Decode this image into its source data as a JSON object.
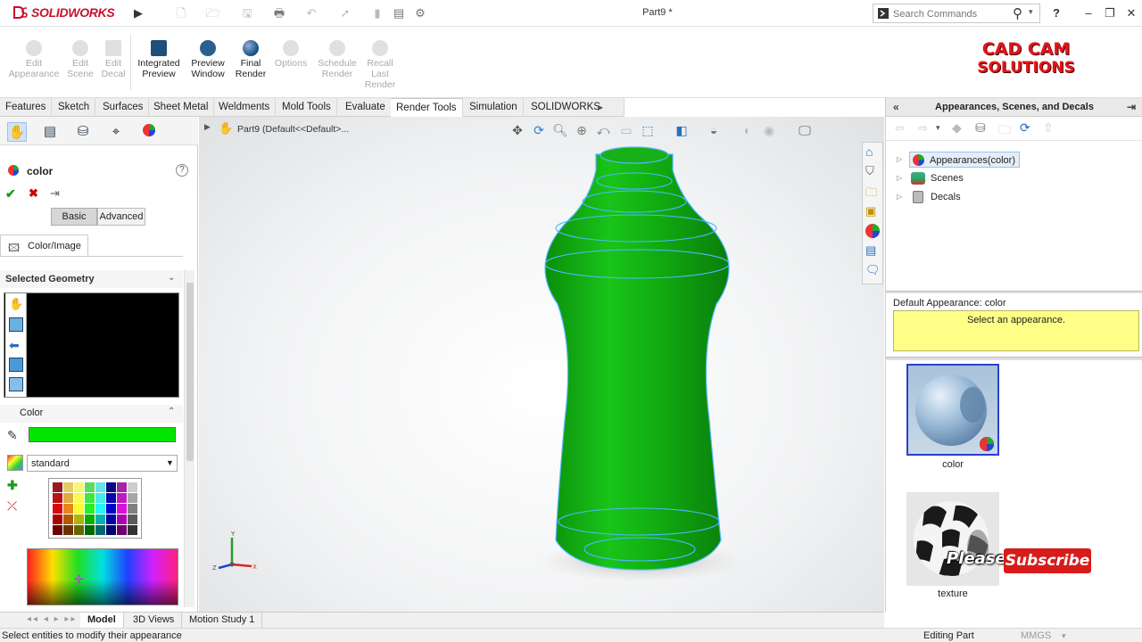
{
  "app": {
    "name": "SOLIDWORKS",
    "doc_title": "Part9 *"
  },
  "search": {
    "placeholder": "Search Commands"
  },
  "commands": [
    {
      "label": "Edit Appearance",
      "enabled": false
    },
    {
      "label": "Edit Scene",
      "enabled": false
    },
    {
      "label": "Edit Decal",
      "enabled": false
    },
    {
      "label": "Integrated Preview",
      "enabled": true
    },
    {
      "label": "Preview Window",
      "enabled": true
    },
    {
      "label": "Final Render",
      "enabled": true
    },
    {
      "label": "Options",
      "enabled": false
    },
    {
      "label": "Schedule Render",
      "enabled": false
    },
    {
      "label": "Recall Last Render",
      "enabled": false
    }
  ],
  "logo_text": {
    "line1": "CAD CAM",
    "line2": "SOLUTIONS"
  },
  "tabs": [
    "Features",
    "Sketch",
    "Surfaces",
    "Sheet Metal",
    "Weldments",
    "Mold Tools",
    "Evaluate",
    "Render Tools",
    "Simulation",
    "SOLIDWORKS MBD"
  ],
  "active_tab": "Render Tools",
  "property_manager": {
    "title": "color",
    "modes": {
      "basic": "Basic",
      "advanced": "Advanced"
    },
    "subtab": "Color/Image",
    "selected_geometry": "Selected Geometry",
    "color_section": "Color",
    "current_color": "#00e600",
    "palette_select": "standard"
  },
  "feature_tree": {
    "path": "Part9  (Default<<Default>..."
  },
  "task_pane": {
    "title": "Appearances, Scenes, and Decals",
    "tree": [
      "Appearances(color)",
      "Scenes",
      "Decals"
    ],
    "default_appearance": "Default Appearance: color",
    "hint": "Select an appearance.",
    "thumbs": [
      {
        "label": "color"
      },
      {
        "label": "texture"
      }
    ]
  },
  "overlay": {
    "please": "Please",
    "subscribe": "Subscribe"
  },
  "bottom_tabs": [
    "Model",
    "3D Views",
    "Motion Study 1"
  ],
  "active_bottom_tab": "Model",
  "status": {
    "message": "Select entities to modify their appearance",
    "mode": "Editing Part",
    "units": "MMGS"
  },
  "colors": {
    "model_green": "#0fa60f",
    "accent_blue": "#2a7fd4",
    "brand_red": "#c8102e"
  }
}
